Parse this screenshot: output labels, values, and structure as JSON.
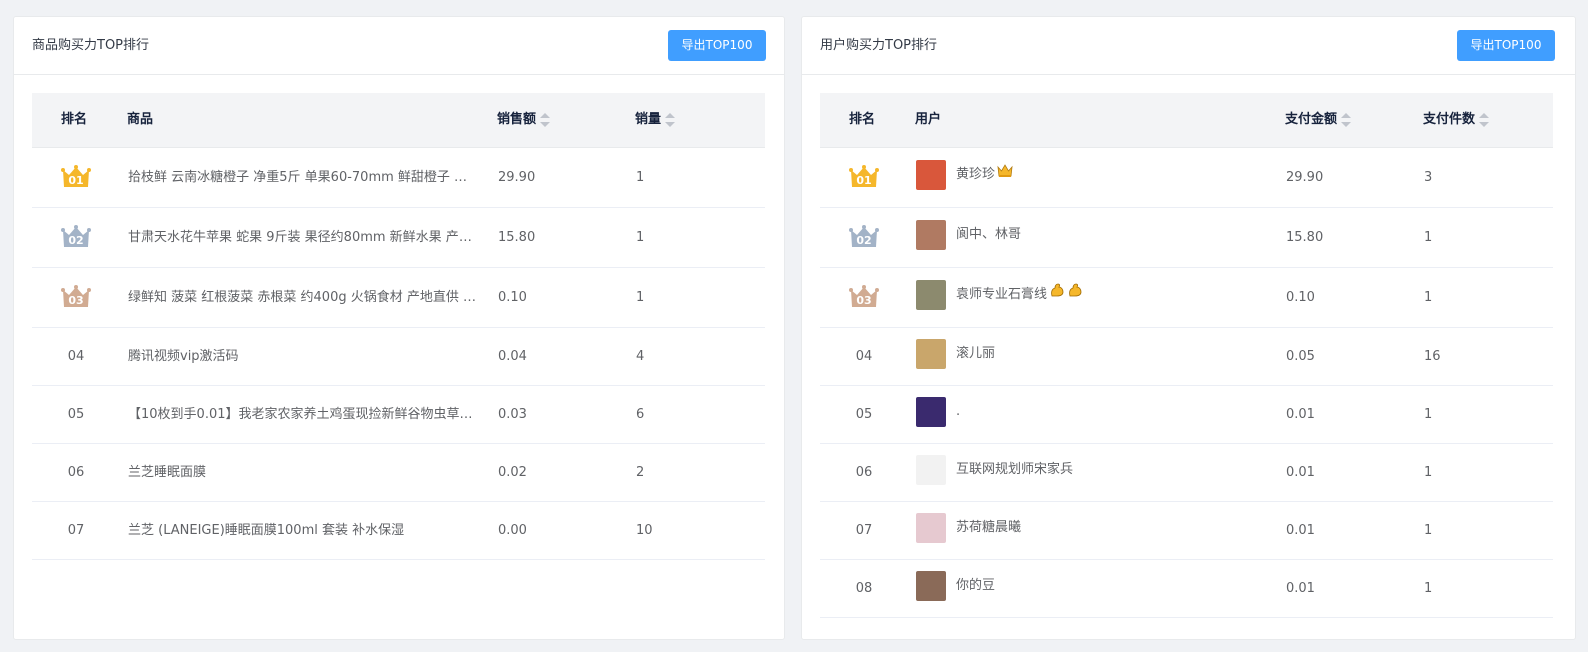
{
  "colors": {
    "accent": "#409eff",
    "crown_gold": "#f5b72b",
    "crown_silver": "#a3b3c7",
    "crown_bronze": "#d1ab92"
  },
  "left": {
    "title": "商品购买力TOP排行",
    "export_label": "导出TOP100",
    "headers": {
      "rank": "排名",
      "product": "商品",
      "sales": "销售额",
      "qty": "销量"
    },
    "rows": [
      {
        "rank": "01",
        "product": "拾枝鲜 云南冰糖橙子 净重5斤 单果60-70mm 鲜甜橙子 产…",
        "sales": "29.90",
        "qty": "1"
      },
      {
        "rank": "02",
        "product": "甘肃天水花牛苹果 蛇果 9斤装 果径约80mm 新鲜水果 产地…",
        "sales": "15.80",
        "qty": "1"
      },
      {
        "rank": "03",
        "product": "绿鲜知 菠菜 红根菠菜 赤根菜 约400g 火锅食材 产地直供 …",
        "sales": "0.10",
        "qty": "1"
      },
      {
        "rank": "04",
        "product": "腾讯视频vip激活码",
        "sales": "0.04",
        "qty": "4"
      },
      {
        "rank": "05",
        "product": "【10枚到手0.01】我老家农家养土鸡蛋现捡新鲜谷物虫草柴…",
        "sales": "0.03",
        "qty": "6"
      },
      {
        "rank": "06",
        "product": "兰芝睡眠面膜",
        "sales": "0.02",
        "qty": "2"
      },
      {
        "rank": "07",
        "product": "兰芝 (LANEIGE)睡眠面膜100ml 套装 补水保湿",
        "sales": "0.00",
        "qty": "10"
      }
    ]
  },
  "right": {
    "title": "用户购买力TOP排行",
    "export_label": "导出TOP100",
    "headers": {
      "rank": "排名",
      "user": "用户",
      "amount": "支付金额",
      "count": "支付件数"
    },
    "rows": [
      {
        "rank": "01",
        "user": "黄珍珍",
        "amount": "29.90",
        "count": "3",
        "avatar_color": "#d9573b",
        "emoji": "crown"
      },
      {
        "rank": "02",
        "user": "阆中、林哥",
        "amount": "15.80",
        "count": "1",
        "avatar_color": "#b07a62",
        "emoji": ""
      },
      {
        "rank": "03",
        "user": "袁师专业石膏线",
        "amount": "0.10",
        "count": "1",
        "avatar_color": "#8c8a6e",
        "emoji": "muscle"
      },
      {
        "rank": "04",
        "user": "滚儿丽",
        "amount": "0.05",
        "count": "16",
        "avatar_color": "#c9a66b",
        "emoji": ""
      },
      {
        "rank": "05",
        "user": ".",
        "amount": "0.01",
        "count": "1",
        "avatar_color": "#3a2a6e",
        "emoji": ""
      },
      {
        "rank": "06",
        "user": "互联网规划师宋家兵",
        "amount": "0.01",
        "count": "1",
        "avatar_color": "#f2f2f2",
        "emoji": ""
      },
      {
        "rank": "07",
        "user": "苏荷糖晨曦",
        "amount": "0.01",
        "count": "1",
        "avatar_color": "#e6c9d0",
        "emoji": ""
      },
      {
        "rank": "08",
        "user": "你的豆",
        "amount": "0.01",
        "count": "1",
        "avatar_color": "#8a6a58",
        "emoji": ""
      }
    ]
  }
}
